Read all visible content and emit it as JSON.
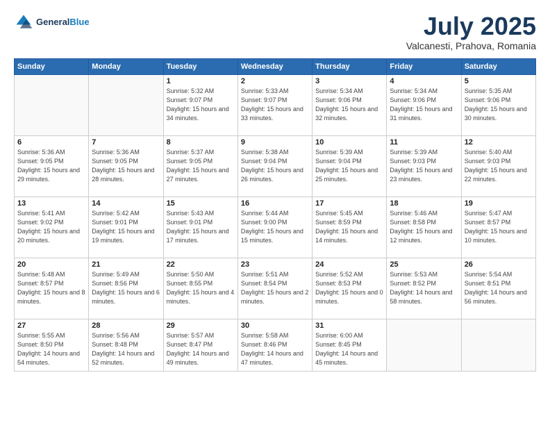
{
  "header": {
    "logo_line1": "General",
    "logo_line2": "Blue",
    "month": "July 2025",
    "location": "Valcanesti, Prahova, Romania"
  },
  "days_of_week": [
    "Sunday",
    "Monday",
    "Tuesday",
    "Wednesday",
    "Thursday",
    "Friday",
    "Saturday"
  ],
  "weeks": [
    [
      {
        "day": "",
        "info": ""
      },
      {
        "day": "",
        "info": ""
      },
      {
        "day": "1",
        "info": "Sunrise: 5:32 AM\nSunset: 9:07 PM\nDaylight: 15 hours\nand 34 minutes."
      },
      {
        "day": "2",
        "info": "Sunrise: 5:33 AM\nSunset: 9:07 PM\nDaylight: 15 hours\nand 33 minutes."
      },
      {
        "day": "3",
        "info": "Sunrise: 5:34 AM\nSunset: 9:06 PM\nDaylight: 15 hours\nand 32 minutes."
      },
      {
        "day": "4",
        "info": "Sunrise: 5:34 AM\nSunset: 9:06 PM\nDaylight: 15 hours\nand 31 minutes."
      },
      {
        "day": "5",
        "info": "Sunrise: 5:35 AM\nSunset: 9:06 PM\nDaylight: 15 hours\nand 30 minutes."
      }
    ],
    [
      {
        "day": "6",
        "info": "Sunrise: 5:36 AM\nSunset: 9:05 PM\nDaylight: 15 hours\nand 29 minutes."
      },
      {
        "day": "7",
        "info": "Sunrise: 5:36 AM\nSunset: 9:05 PM\nDaylight: 15 hours\nand 28 minutes."
      },
      {
        "day": "8",
        "info": "Sunrise: 5:37 AM\nSunset: 9:05 PM\nDaylight: 15 hours\nand 27 minutes."
      },
      {
        "day": "9",
        "info": "Sunrise: 5:38 AM\nSunset: 9:04 PM\nDaylight: 15 hours\nand 26 minutes."
      },
      {
        "day": "10",
        "info": "Sunrise: 5:39 AM\nSunset: 9:04 PM\nDaylight: 15 hours\nand 25 minutes."
      },
      {
        "day": "11",
        "info": "Sunrise: 5:39 AM\nSunset: 9:03 PM\nDaylight: 15 hours\nand 23 minutes."
      },
      {
        "day": "12",
        "info": "Sunrise: 5:40 AM\nSunset: 9:03 PM\nDaylight: 15 hours\nand 22 minutes."
      }
    ],
    [
      {
        "day": "13",
        "info": "Sunrise: 5:41 AM\nSunset: 9:02 PM\nDaylight: 15 hours\nand 20 minutes."
      },
      {
        "day": "14",
        "info": "Sunrise: 5:42 AM\nSunset: 9:01 PM\nDaylight: 15 hours\nand 19 minutes."
      },
      {
        "day": "15",
        "info": "Sunrise: 5:43 AM\nSunset: 9:01 PM\nDaylight: 15 hours\nand 17 minutes."
      },
      {
        "day": "16",
        "info": "Sunrise: 5:44 AM\nSunset: 9:00 PM\nDaylight: 15 hours\nand 15 minutes."
      },
      {
        "day": "17",
        "info": "Sunrise: 5:45 AM\nSunset: 8:59 PM\nDaylight: 15 hours\nand 14 minutes."
      },
      {
        "day": "18",
        "info": "Sunrise: 5:46 AM\nSunset: 8:58 PM\nDaylight: 15 hours\nand 12 minutes."
      },
      {
        "day": "19",
        "info": "Sunrise: 5:47 AM\nSunset: 8:57 PM\nDaylight: 15 hours\nand 10 minutes."
      }
    ],
    [
      {
        "day": "20",
        "info": "Sunrise: 5:48 AM\nSunset: 8:57 PM\nDaylight: 15 hours\nand 8 minutes."
      },
      {
        "day": "21",
        "info": "Sunrise: 5:49 AM\nSunset: 8:56 PM\nDaylight: 15 hours\nand 6 minutes."
      },
      {
        "day": "22",
        "info": "Sunrise: 5:50 AM\nSunset: 8:55 PM\nDaylight: 15 hours\nand 4 minutes."
      },
      {
        "day": "23",
        "info": "Sunrise: 5:51 AM\nSunset: 8:54 PM\nDaylight: 15 hours\nand 2 minutes."
      },
      {
        "day": "24",
        "info": "Sunrise: 5:52 AM\nSunset: 8:53 PM\nDaylight: 15 hours\nand 0 minutes."
      },
      {
        "day": "25",
        "info": "Sunrise: 5:53 AM\nSunset: 8:52 PM\nDaylight: 14 hours\nand 58 minutes."
      },
      {
        "day": "26",
        "info": "Sunrise: 5:54 AM\nSunset: 8:51 PM\nDaylight: 14 hours\nand 56 minutes."
      }
    ],
    [
      {
        "day": "27",
        "info": "Sunrise: 5:55 AM\nSunset: 8:50 PM\nDaylight: 14 hours\nand 54 minutes."
      },
      {
        "day": "28",
        "info": "Sunrise: 5:56 AM\nSunset: 8:48 PM\nDaylight: 14 hours\nand 52 minutes."
      },
      {
        "day": "29",
        "info": "Sunrise: 5:57 AM\nSunset: 8:47 PM\nDaylight: 14 hours\nand 49 minutes."
      },
      {
        "day": "30",
        "info": "Sunrise: 5:58 AM\nSunset: 8:46 PM\nDaylight: 14 hours\nand 47 minutes."
      },
      {
        "day": "31",
        "info": "Sunrise: 6:00 AM\nSunset: 8:45 PM\nDaylight: 14 hours\nand 45 minutes."
      },
      {
        "day": "",
        "info": ""
      },
      {
        "day": "",
        "info": ""
      }
    ]
  ]
}
